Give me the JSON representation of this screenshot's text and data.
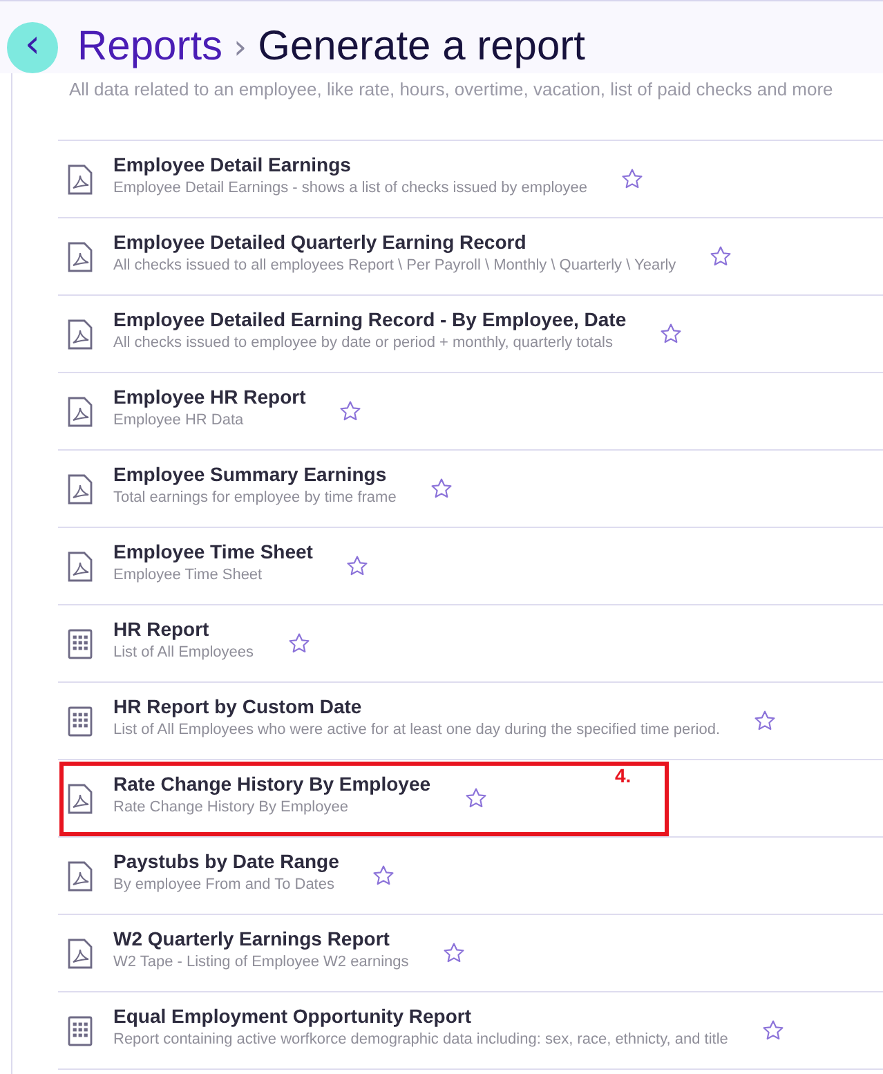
{
  "header": {
    "back_button": "‹",
    "breadcrumb": "Reports",
    "separator": "›",
    "title": "Generate a report"
  },
  "description": "All data related to an employee, like rate, hours, overtime, vacation, list of paid checks and more",
  "reports": [
    {
      "kind": "pdf",
      "title": "Employee Detail Earnings",
      "subtitle": "Employee Detail Earnings - shows a list of checks issued by employee",
      "favorite": false,
      "highlighted": false
    },
    {
      "kind": "pdf",
      "title": "Employee Detailed Quarterly Earning Record",
      "subtitle": "All checks issued to all employees Report \\ Per Payroll \\ Monthly \\ Quarterly \\ Yearly",
      "favorite": false,
      "highlighted": false
    },
    {
      "kind": "pdf",
      "title": "Employee Detailed Earning Record - By Employee, Date",
      "subtitle": "All checks issued to employee by date or period + monthly, quarterly totals",
      "favorite": false,
      "highlighted": false
    },
    {
      "kind": "pdf",
      "title": "Employee HR Report",
      "subtitle": "Employee HR Data",
      "favorite": false,
      "highlighted": false
    },
    {
      "kind": "pdf",
      "title": "Employee Summary Earnings",
      "subtitle": "Total earnings for employee by time frame",
      "favorite": false,
      "highlighted": false
    },
    {
      "kind": "pdf",
      "title": "Employee Time Sheet",
      "subtitle": "Employee Time Sheet",
      "favorite": false,
      "highlighted": false
    },
    {
      "kind": "grid",
      "title": "HR Report",
      "subtitle": "List of All Employees",
      "favorite": false,
      "highlighted": false
    },
    {
      "kind": "grid",
      "title": "HR Report by Custom Date",
      "subtitle": "List of All Employees who were active for at least one day during the specified time period.",
      "favorite": false,
      "highlighted": false
    },
    {
      "kind": "pdf",
      "title": "Rate Change History By Employee",
      "subtitle": "Rate Change History By Employee",
      "favorite": false,
      "highlighted": true,
      "annotation": "4."
    },
    {
      "kind": "pdf",
      "title": "Paystubs by Date Range",
      "subtitle": "By employee From and To Dates",
      "favorite": false,
      "highlighted": false
    },
    {
      "kind": "pdf",
      "title": "W2 Quarterly Earnings Report",
      "subtitle": "W2 Tape - Listing of Employee W2 earnings",
      "favorite": false,
      "highlighted": false
    },
    {
      "kind": "grid",
      "title": "Equal Employment Opportunity Report",
      "subtitle": "Report containing active worfkorce demographic data including: sex, race, ethnicty, and title",
      "favorite": false,
      "highlighted": false
    }
  ]
}
